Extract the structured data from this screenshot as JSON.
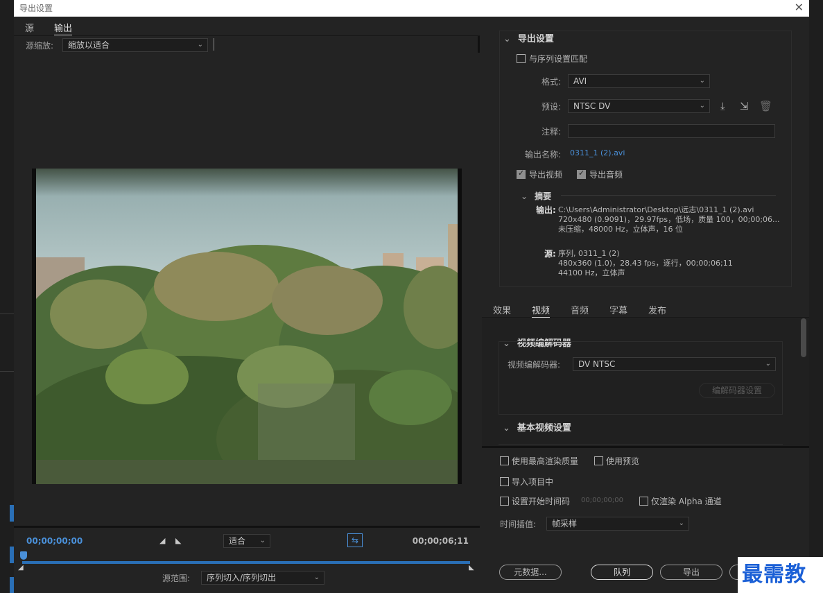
{
  "window": {
    "title": "导出设置"
  },
  "left_tabs": [
    {
      "label": "源"
    },
    {
      "label": "输出"
    }
  ],
  "source_scale": {
    "label": "源缩放:",
    "value": "缩放以适合"
  },
  "timeline": {
    "start_tc": "00;00;00;00",
    "end_tc": "00;00;06;11",
    "zoom_value": "适合",
    "range_label": "源范围:",
    "range_value": "序列切入/序列切出",
    "playhead_fraction": 0.0
  },
  "export_settings": {
    "header": "导出设置",
    "match_sequence": "与序列设置匹配",
    "format_label": "格式:",
    "format_value": "AVI",
    "preset_label": "预设:",
    "preset_value": "NTSC DV",
    "comment_label": "注释:",
    "comment_value": "",
    "output_name_label": "输出名称:",
    "output_name_value": "0311_1 (2).avi",
    "export_video": "导出视频",
    "export_audio": "导出音频",
    "summary_header": "摘要",
    "output_key": "输出:",
    "output_lines": [
      "C:\\Users\\Administrator\\Desktop\\远志\\0311_1  (2).avi",
      "720x480  (0.9091)，29.97fps，低场，质量 100，00;00;06...",
      "未压缩，48000 Hz，立体声，16 位"
    ],
    "source_key": "源:",
    "source_lines": [
      "序列, 0311_1 (2)",
      "480x360  (1.0)，28.43  fps，逐行，00;00;06;11",
      "44100 Hz，立体声"
    ]
  },
  "right_tabs": [
    {
      "label": "效果"
    },
    {
      "label": "视频"
    },
    {
      "label": "音频"
    },
    {
      "label": "字幕"
    },
    {
      "label": "发布"
    }
  ],
  "video_codec": {
    "header": "视频编解码器",
    "codec_label": "视频编解码器:",
    "codec_value": "DV NTSC",
    "codec_settings_btn": "编解码器设置",
    "basic_header": "基本视频设置"
  },
  "options": {
    "max_render_quality": "使用最高渲染质量",
    "use_previews": "使用预览",
    "import_into_project": "导入项目中",
    "set_start_timecode": "设置开始时间码",
    "start_timecode_value": "00;00;00;00",
    "render_alpha_only": "仅渲染 Alpha 通道",
    "time_interpolation_label": "时间插值:",
    "time_interpolation_value": "帧采样"
  },
  "buttons": {
    "metadata": "元数据...",
    "queue": "队列",
    "export": "导出"
  },
  "watermark": "最需教育",
  "colors": {
    "accent": "#4a90d9",
    "track": "#2a6fb6",
    "panel": "#232323",
    "titlebar": "#ffffff"
  }
}
